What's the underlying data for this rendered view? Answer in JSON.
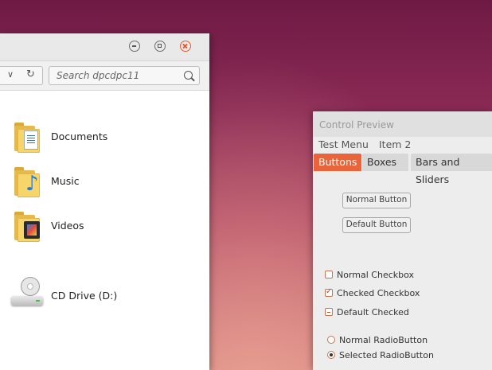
{
  "explorer": {
    "search_placeholder": "Search dpcdpc11",
    "items": [
      {
        "label": "Documents",
        "icon": "documents-folder-icon"
      },
      {
        "label": "Music",
        "icon": "music-folder-icon"
      },
      {
        "label": "Videos",
        "icon": "videos-folder-icon"
      },
      {
        "label": "CD Drive (D:)",
        "icon": "cd-drive-icon"
      }
    ]
  },
  "preview": {
    "title": "Control Preview",
    "menu": [
      "Test Menu",
      "Item 2"
    ],
    "tabs": [
      "Buttons",
      "Boxes",
      "Bars and Sliders"
    ],
    "active_tab": "Buttons",
    "buttons": [
      "Normal Button",
      "Default Button"
    ],
    "checkboxes": [
      {
        "label": "Normal Checkbox",
        "state": "unchecked"
      },
      {
        "label": "Checked Checkbox",
        "state": "checked"
      },
      {
        "label": "Default Checked",
        "state": "indeterminate"
      }
    ],
    "radios": [
      {
        "label": "Normal RadioButton",
        "selected": false
      },
      {
        "label": "Selected RadioButton",
        "selected": true
      }
    ]
  },
  "colors": {
    "accent": "#e9643b",
    "close": "#e45b2f"
  }
}
